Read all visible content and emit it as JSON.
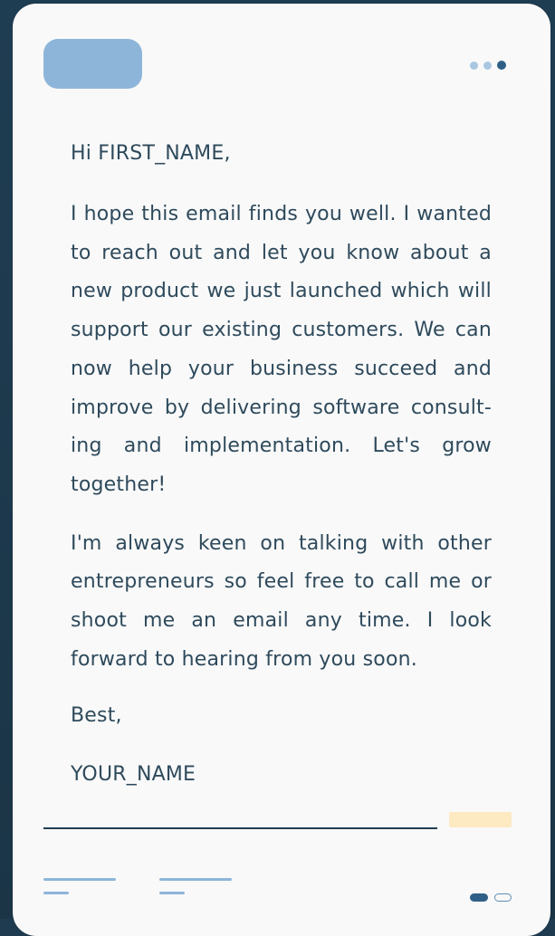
{
  "email": {
    "greeting": "Hi FIRST_NAME,",
    "paragraph_1": "I hope this email finds you well. I wanted to reach out and let you know about a new product we just launched which will support our existing customers. We can now help your business succeed and improve by delivering software consult-ing and implementation. Let's grow together!",
    "paragraph_2": "I'm always keen on talking with other entrepreneurs so feel free to call me or shoot me an email any time. I look forward to hearing from you soon.",
    "sign_off": "Best,",
    "signature": "YOUR_NAME"
  },
  "header": {
    "step_indicator": {
      "total": 3,
      "active_index": 3
    }
  },
  "pagination": {
    "total": 2,
    "active_index": 1
  },
  "colors": {
    "background": "#1e3b4f",
    "card": "#f9f9f9",
    "text": "#2e4a5c",
    "accent_light": "#8db5d9",
    "accent_dark": "#2f5f86",
    "highlight": "#fde9c2"
  }
}
